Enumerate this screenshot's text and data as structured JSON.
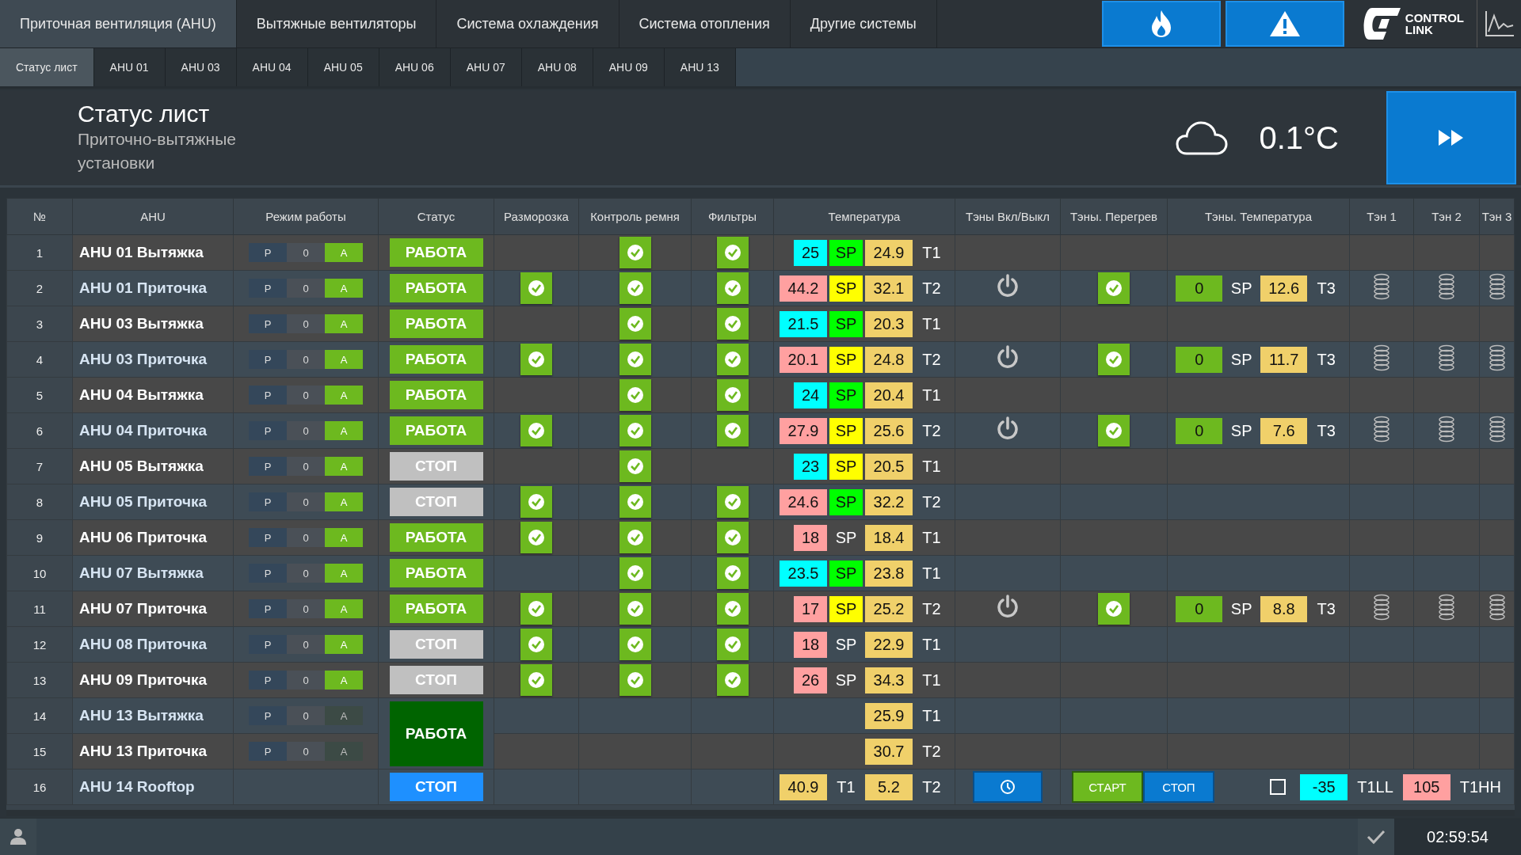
{
  "nav_tabs": [
    {
      "label": "Приточная вентиляция (AHU)",
      "selected": true
    },
    {
      "label": "Вытяжные вентиляторы",
      "selected": false
    },
    {
      "label": "Система охлаждения",
      "selected": false
    },
    {
      "label": "Система отопления",
      "selected": false
    },
    {
      "label": "Другие системы",
      "selected": false
    }
  ],
  "logo": {
    "lines": [
      "CONTROL",
      "LINK"
    ]
  },
  "sub_tabs": [
    {
      "label": "Статус лист",
      "selected": true
    },
    {
      "label": "AHU 01",
      "selected": false
    },
    {
      "label": "AHU 03",
      "selected": false
    },
    {
      "label": "AHU 04",
      "selected": false
    },
    {
      "label": "AHU 05",
      "selected": false
    },
    {
      "label": "AHU 06",
      "selected": false
    },
    {
      "label": "AHU 07",
      "selected": false
    },
    {
      "label": "AHU 08",
      "selected": false
    },
    {
      "label": "AHU 09",
      "selected": false
    },
    {
      "label": "AHU 13",
      "selected": false
    }
  ],
  "header": {
    "title": "Статус лист",
    "subtitle": "Приточно-вытяжные установки",
    "outdoor_temp": "0.1°C"
  },
  "columns": [
    "№",
    "AHU",
    "Режим работы",
    "Статус",
    "Разморозка",
    "Контроль ремня",
    "Фильтры",
    "Температура",
    "Тэны Вкл/Выкл",
    "Тэны. Перегрев",
    "Тэны. Температура",
    "Тэн 1",
    "Тэн 2",
    "Тэн 3"
  ],
  "rows": [
    {
      "num": "1",
      "name": "AHU 01 Вытяжка",
      "mode": {
        "labels": [
          "P",
          "0",
          "A"
        ],
        "auto": true
      },
      "status": {
        "text": "РАБОТА",
        "color": "#6db91f"
      },
      "defrost": false,
      "belt": true,
      "filters": true,
      "temperature": [
        {
          "kind": "value",
          "text": "25",
          "color": "#00ffff"
        },
        {
          "kind": "value",
          "text": "SP",
          "color": "#00ff00"
        },
        {
          "kind": "value",
          "text": "24.9",
          "color": "#f0d06a"
        },
        {
          "kind": "label",
          "text": "T1"
        }
      ]
    },
    {
      "num": "2",
      "name": "AHU 01 Приточка",
      "mode": {
        "labels": [
          "P",
          "0",
          "A"
        ],
        "auto": true
      },
      "status": {
        "text": "РАБОТА",
        "color": "#6db91f"
      },
      "defrost": true,
      "belt": true,
      "filters": true,
      "temperature": [
        {
          "kind": "value",
          "text": "44.2",
          "color": "#ffa0a0"
        },
        {
          "kind": "value",
          "text": "SP",
          "color": "#ffff00"
        },
        {
          "kind": "value",
          "text": "32.1",
          "color": "#f0d06a"
        },
        {
          "kind": "label",
          "text": "T2"
        }
      ],
      "heater": {
        "switch": true,
        "overheat_ok": true,
        "temp": [
          {
            "kind": "value",
            "text": "0",
            "color": "#6db91f"
          },
          {
            "kind": "label",
            "text": "SP"
          },
          {
            "kind": "value",
            "text": "12.6",
            "color": "#f0d06a"
          },
          {
            "kind": "label",
            "text": "T3"
          }
        ],
        "coils": [
          true,
          true,
          true
        ]
      }
    },
    {
      "num": "3",
      "name": "AHU 03 Вытяжка",
      "mode": {
        "labels": [
          "P",
          "0",
          "A"
        ],
        "auto": true
      },
      "status": {
        "text": "РАБОТА",
        "color": "#6db91f"
      },
      "defrost": false,
      "belt": true,
      "filters": true,
      "temperature": [
        {
          "kind": "value",
          "text": "21.5",
          "color": "#00ffff"
        },
        {
          "kind": "value",
          "text": "SP",
          "color": "#00ff00"
        },
        {
          "kind": "value",
          "text": "20.3",
          "color": "#f0d06a"
        },
        {
          "kind": "label",
          "text": "T1"
        }
      ]
    },
    {
      "num": "4",
      "name": "AHU 03 Приточка",
      "mode": {
        "labels": [
          "P",
          "0",
          "A"
        ],
        "auto": true
      },
      "status": {
        "text": "РАБОТА",
        "color": "#6db91f"
      },
      "defrost": true,
      "belt": true,
      "filters": true,
      "temperature": [
        {
          "kind": "value",
          "text": "20.1",
          "color": "#ffa0a0"
        },
        {
          "kind": "value",
          "text": "SP",
          "color": "#ffff00"
        },
        {
          "kind": "value",
          "text": "24.8",
          "color": "#f0d06a"
        },
        {
          "kind": "label",
          "text": "T2"
        }
      ],
      "heater": {
        "switch": true,
        "overheat_ok": true,
        "temp": [
          {
            "kind": "value",
            "text": "0",
            "color": "#6db91f"
          },
          {
            "kind": "label",
            "text": "SP"
          },
          {
            "kind": "value",
            "text": "11.7",
            "color": "#f0d06a"
          },
          {
            "kind": "label",
            "text": "T3"
          }
        ],
        "coils": [
          true,
          true,
          true
        ]
      }
    },
    {
      "num": "5",
      "name": "AHU 04 Вытяжка",
      "mode": {
        "labels": [
          "P",
          "0",
          "A"
        ],
        "auto": true
      },
      "status": {
        "text": "РАБОТА",
        "color": "#6db91f"
      },
      "defrost": false,
      "belt": true,
      "filters": true,
      "temperature": [
        {
          "kind": "value",
          "text": "24",
          "color": "#00ffff"
        },
        {
          "kind": "value",
          "text": "SP",
          "color": "#00ff00"
        },
        {
          "kind": "value",
          "text": "20.4",
          "color": "#f0d06a"
        },
        {
          "kind": "label",
          "text": "T1"
        }
      ]
    },
    {
      "num": "6",
      "name": "AHU 04 Приточка",
      "mode": {
        "labels": [
          "P",
          "0",
          "A"
        ],
        "auto": true
      },
      "status": {
        "text": "РАБОТА",
        "color": "#6db91f"
      },
      "defrost": true,
      "belt": true,
      "filters": true,
      "temperature": [
        {
          "kind": "value",
          "text": "27.9",
          "color": "#ffa0a0"
        },
        {
          "kind": "value",
          "text": "SP",
          "color": "#ffff00"
        },
        {
          "kind": "value",
          "text": "25.6",
          "color": "#f0d06a"
        },
        {
          "kind": "label",
          "text": "T2"
        }
      ],
      "heater": {
        "switch": true,
        "overheat_ok": true,
        "temp": [
          {
            "kind": "value",
            "text": "0",
            "color": "#6db91f"
          },
          {
            "kind": "label",
            "text": "SP"
          },
          {
            "kind": "value",
            "text": "7.6",
            "color": "#f0d06a"
          },
          {
            "kind": "label",
            "text": "T3"
          }
        ],
        "coils": [
          true,
          true,
          true
        ]
      }
    },
    {
      "num": "7",
      "name": "AHU 05 Вытяжка",
      "mode": {
        "labels": [
          "P",
          "0",
          "A"
        ],
        "auto": true
      },
      "status": {
        "text": "СТОП",
        "color": "#c0c0c0"
      },
      "defrost": false,
      "belt": true,
      "filters": false,
      "temperature": [
        {
          "kind": "value",
          "text": "23",
          "color": "#00ffff"
        },
        {
          "kind": "value",
          "text": "SP",
          "color": "#ffff00"
        },
        {
          "kind": "value",
          "text": "20.5",
          "color": "#f0d06a"
        },
        {
          "kind": "label",
          "text": "T1"
        }
      ]
    },
    {
      "num": "8",
      "name": "AHU 05 Приточка",
      "mode": {
        "labels": [
          "P",
          "0",
          "A"
        ],
        "auto": true
      },
      "status": {
        "text": "СТОП",
        "color": "#c0c0c0"
      },
      "defrost": true,
      "belt": true,
      "filters": true,
      "temperature": [
        {
          "kind": "value",
          "text": "24.6",
          "color": "#ffa0a0"
        },
        {
          "kind": "value",
          "text": "SP",
          "color": "#00ff00"
        },
        {
          "kind": "value",
          "text": "32.2",
          "color": "#f0d06a"
        },
        {
          "kind": "label",
          "text": "T2"
        }
      ]
    },
    {
      "num": "9",
      "name": "AHU 06 Приточка",
      "mode": {
        "labels": [
          "P",
          "0",
          "A"
        ],
        "auto": true
      },
      "status": {
        "text": "РАБОТА",
        "color": "#6db91f"
      },
      "defrost": true,
      "belt": true,
      "filters": true,
      "temperature": [
        {
          "kind": "value",
          "text": "18",
          "color": "#ffa0a0"
        },
        {
          "kind": "label",
          "text": "SP"
        },
        {
          "kind": "value",
          "text": "18.4",
          "color": "#f0d06a"
        },
        {
          "kind": "label",
          "text": "T1"
        }
      ]
    },
    {
      "num": "10",
      "name": "AHU 07 Вытяжка",
      "mode": {
        "labels": [
          "P",
          "0",
          "A"
        ],
        "auto": true
      },
      "status": {
        "text": "РАБОТА",
        "color": "#6db91f"
      },
      "defrost": false,
      "belt": true,
      "filters": true,
      "temperature": [
        {
          "kind": "value",
          "text": "23.5",
          "color": "#00ffff"
        },
        {
          "kind": "value",
          "text": "SP",
          "color": "#00ff00"
        },
        {
          "kind": "value",
          "text": "23.8",
          "color": "#f0d06a"
        },
        {
          "kind": "label",
          "text": "T1"
        }
      ]
    },
    {
      "num": "11",
      "name": "AHU 07 Приточка",
      "mode": {
        "labels": [
          "P",
          "0",
          "A"
        ],
        "auto": true
      },
      "status": {
        "text": "РАБОТА",
        "color": "#6db91f"
      },
      "defrost": true,
      "belt": true,
      "filters": true,
      "temperature": [
        {
          "kind": "value",
          "text": "17",
          "color": "#ffa0a0"
        },
        {
          "kind": "value",
          "text": "SP",
          "color": "#ffff00"
        },
        {
          "kind": "value",
          "text": "25.2",
          "color": "#f0d06a"
        },
        {
          "kind": "label",
          "text": "T2"
        }
      ],
      "heater": {
        "switch": true,
        "overheat_ok": true,
        "temp": [
          {
            "kind": "value",
            "text": "0",
            "color": "#6db91f"
          },
          {
            "kind": "label",
            "text": "SP"
          },
          {
            "kind": "value",
            "text": "8.8",
            "color": "#f0d06a"
          },
          {
            "kind": "label",
            "text": "T3"
          }
        ],
        "coils": [
          true,
          true,
          true
        ]
      }
    },
    {
      "num": "12",
      "name": "AHU 08 Приточка",
      "mode": {
        "labels": [
          "P",
          "0",
          "A"
        ],
        "auto": true
      },
      "status": {
        "text": "СТОП",
        "color": "#c0c0c0"
      },
      "defrost": true,
      "belt": true,
      "filters": true,
      "temperature": [
        {
          "kind": "value",
          "text": "18",
          "color": "#ffa0a0"
        },
        {
          "kind": "label",
          "text": "SP"
        },
        {
          "kind": "value",
          "text": "22.9",
          "color": "#f0d06a"
        },
        {
          "kind": "label",
          "text": "T1"
        }
      ]
    },
    {
      "num": "13",
      "name": "AHU 09 Приточка",
      "mode": {
        "labels": [
          "P",
          "0",
          "A"
        ],
        "auto": true
      },
      "status": {
        "text": "СТОП",
        "color": "#c0c0c0"
      },
      "defrost": true,
      "belt": true,
      "filters": true,
      "temperature": [
        {
          "kind": "value",
          "text": "26",
          "color": "#ffa0a0"
        },
        {
          "kind": "label",
          "text": "SP"
        },
        {
          "kind": "value",
          "text": "34.3",
          "color": "#f0d06a"
        },
        {
          "kind": "label",
          "text": "T1"
        }
      ]
    },
    {
      "num": "14",
      "name": "AHU 13 Вытяжка",
      "mode": {
        "labels": [
          "P",
          "0",
          "A"
        ],
        "auto": false
      },
      "status": {
        "text": "РАБОТА",
        "color": "#006400",
        "span_next": true
      },
      "defrost": false,
      "belt": false,
      "filters": false,
      "temperature": [
        {
          "kind": "value",
          "text": "25.9",
          "color": "#f0d06a"
        },
        {
          "kind": "label",
          "text": "T1"
        }
      ]
    },
    {
      "num": "15",
      "name": "AHU 13 Приточка",
      "mode": {
        "labels": [
          "P",
          "0",
          "A"
        ],
        "auto": false
      },
      "defrost": false,
      "belt": false,
      "filters": false,
      "temperature": [
        {
          "kind": "value",
          "text": "30.7",
          "color": "#f0d06a"
        },
        {
          "kind": "label",
          "text": "T2"
        }
      ]
    },
    {
      "num": "16",
      "name": "AHU 14 Rooftop",
      "status": {
        "text": "СТОП",
        "color": "#1e90ff"
      },
      "defrost": false,
      "belt": false,
      "filters": false,
      "temperature": [
        {
          "kind": "value",
          "text": "40.9",
          "color": "#f0d06a"
        },
        {
          "kind": "label",
          "text": "T1"
        },
        {
          "kind": "value",
          "text": "5.2",
          "color": "#f0d06a"
        },
        {
          "kind": "label",
          "text": "T2"
        }
      ],
      "controls": {
        "buttons": [
          {
            "text": "СТАРТ",
            "selected": true
          },
          {
            "text": "СТОП",
            "selected": false
          }
        ],
        "checkbox": false,
        "limits": [
          {
            "kind": "value",
            "text": "-35",
            "color": "#00ffff"
          },
          {
            "kind": "label",
            "text": "T1LL"
          },
          {
            "kind": "value",
            "text": "105",
            "color": "#ffa0a0"
          },
          {
            "kind": "label",
            "text": "T1HH"
          }
        ]
      }
    }
  ],
  "status_bar": {
    "time": "02:59:54"
  }
}
